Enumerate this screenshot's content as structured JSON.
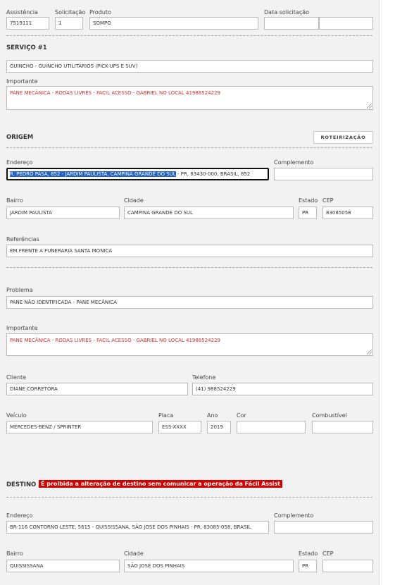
{
  "header": {
    "assistencia_label": "Assistência",
    "assistencia_value": "7519111",
    "solicitacao_label": "Solicitação",
    "solicitacao_value": "1",
    "produto_label": "Produto",
    "produto_value": "SOMPO",
    "data_label": "Data solicitação",
    "data_value1": "",
    "data_value2": ""
  },
  "servico": {
    "title": "SERVIÇO #1",
    "tipo_value": "GUINCHO - GUINCHO UTILITÁRIOS (PICK-UPS E SUV)",
    "importante_label": "Importante",
    "importante_value": "PANE MECÂNICA - RODAS LIVRES - FACIL ACESSO -  GABRIEL NO LOCAL 41988524229"
  },
  "origem": {
    "title": "ORIGEM",
    "roteirizacao_label": "ROTEIRIZAÇÃO",
    "endereco_label": "Endereço",
    "endereco_selected": "R. PEDRO PASA, 852 - JARDIM PAULISTA, CAMPINA GRANDE DO SUL",
    "endereco_rest": " - PR, 83430-000, BRASIL, 852",
    "complemento_label": "Complemento",
    "complemento_value": "",
    "bairro_label": "Bairro",
    "bairro_value": "JARDIM PAULISTA",
    "cidade_label": "Cidade",
    "cidade_value": "CAMPINA GRANDE DO SUL",
    "estado_label": "Estado",
    "estado_value": "PR",
    "cep_label": "CEP",
    "cep_value": "83085058",
    "referencias_label": "Referências",
    "referencias_value": "EM FRENTE A FUNERARIA SANTA MONICA"
  },
  "problema": {
    "problema_label": "Problema",
    "problema_value": "PANE NÃO IDENTIFICADA - PANE MECÂNICA",
    "importante_label": "Importante",
    "importante_value": "PANE MECÂNICA - RODAS LIVRES - FACIL ACESSO -  GABRIEL NO LOCAL 41988524229",
    "cliente_label": "Cliente",
    "cliente_value": "DIANE CORRETORA",
    "telefone_label": "Telefone",
    "telefone_value": "(41) 988524229",
    "veiculo_label": "Veículo",
    "veiculo_value": "MERCEDES-BENZ / SPRINTER",
    "placa_label": "Placa",
    "placa_value": "ESS-XXXX",
    "ano_label": "Ano",
    "ano_value": "2019",
    "cor_label": "Cor",
    "cor_value": "",
    "combustivel_label": "Combustível",
    "combustivel_value": ""
  },
  "destino": {
    "title": "DESTINO",
    "warning": "É proibida a alteração de destino sem comunicar a operação da Fácil Assist",
    "endereco_label": "Endereço",
    "endereco_value": "BR-116 CONTORNO LESTE, 5615 - QUISSISSANA, SÃO JOSÉ DOS PINHAIS - PR, 83085-058, BRASIL",
    "complemento_label": "Complemento",
    "complemento_value": "",
    "bairro_label": "Bairro",
    "bairro_value": "QUISSISSANA",
    "cidade_label": "Cidade",
    "cidade_value": "SÃO JOSÉ DOS PINHAIS",
    "estado_label": "Estado",
    "estado_value": "PR",
    "cep_label": "CEP",
    "cep_value": ""
  },
  "colors": {
    "panel": "#f2f2f2",
    "warning_bg": "#d40000",
    "important_text": "#d32f2f",
    "selection": "#2160c4"
  }
}
